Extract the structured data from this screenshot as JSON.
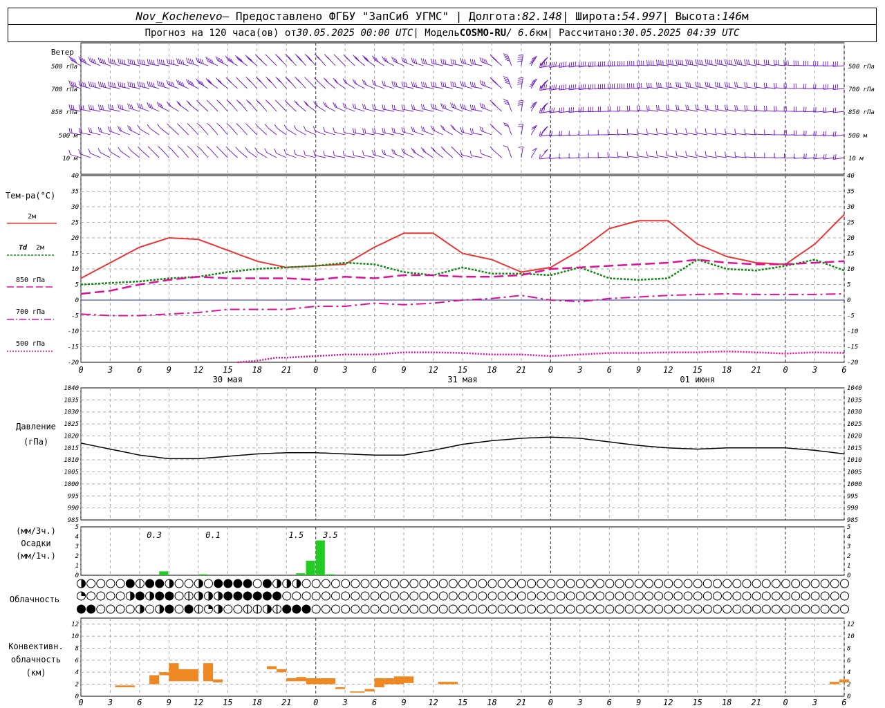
{
  "header": {
    "station": "Nov_Kochenevo",
    "provider": " — Предоставлено ФГБУ \"ЗапСиб УГМС\" | Долгота: ",
    "lon": "82.148",
    "lat_label": " | Широта: ",
    "lat": "54.997",
    "alt_label": " | Высота: ",
    "alt": "146",
    "alt_unit": "м",
    "forecast_prefix": "Прогноз на 120 часа(ов) от ",
    "forecast_time": "30.05.2025 00:00 UTC",
    "model_prefix": "  | Модель ",
    "model": "COSMO-RU",
    "resolution": " / 6.6",
    "res_unit": "км",
    "computed_prefix": " | Рассчитано: ",
    "computed_time": "30.05.2025 04:39 UTC"
  },
  "axis": {
    "hour_labels": [
      "0",
      "3",
      "6",
      "9",
      "12",
      "15",
      "18",
      "21",
      "0",
      "3",
      "6",
      "9",
      "12",
      "15",
      "18",
      "21",
      "0",
      "3",
      "6",
      "9",
      "12",
      "15",
      "18",
      "21",
      "0",
      "3",
      "6"
    ],
    "date_labels": [
      {
        "hour": 15,
        "text": "30 мая"
      },
      {
        "hour": 39,
        "text": "31 мая"
      },
      {
        "hour": 63,
        "text": "01 июня"
      }
    ]
  },
  "labels": {
    "wind_title": "Ветер",
    "wind_levels": [
      "500 гПа",
      "700 гПа",
      "850 гПа",
      "500 м",
      "10 м"
    ],
    "temp_title": "Тем-ра(°C)",
    "legend_2m": "2м",
    "legend_td": "Td",
    "legend_td_2m": "2м",
    "legend_850": "850 гПа",
    "legend_700": "700 гПа",
    "legend_500": "500 гПа",
    "pressure_title": "Давление",
    "pressure_unit": "(гПа)",
    "precip_unit3": "(мм/3ч.)",
    "precip_title": "Осадки",
    "precip_unit1": "(мм/1ч.)",
    "cloud_title": "Облачность",
    "conv_title1": "Конвективн.",
    "conv_title2": "облачность",
    "conv_title3": "(км)"
  },
  "colors": {
    "t2m": "#ee3333",
    "td": "#118811",
    "upper": "#dd1199",
    "pressure": "#000000",
    "precip": "#22cc22",
    "conv": "#ee8822",
    "wind": "#6611cc",
    "zero_line": "#2222cc"
  },
  "chart_data": [
    {
      "type": "line",
      "title": "Ветер",
      "levels": [
        "500 гПа",
        "700 гПа",
        "850 гПа",
        "500 м",
        "10 м"
      ],
      "note": "wind barbs, hourly"
    },
    {
      "type": "line",
      "title": "Тем-ра(°C)",
      "ylim": [
        -20,
        40
      ],
      "yticks": [
        -20,
        -15,
        -10,
        -5,
        0,
        5,
        10,
        15,
        20,
        25,
        30,
        35,
        40
      ],
      "series": [
        {
          "name": "2м",
          "x": [
            0,
            3,
            6,
            9,
            12,
            15,
            18,
            21,
            24,
            27,
            30,
            33,
            36,
            39,
            42,
            45,
            48,
            51,
            54,
            57,
            60,
            63,
            66,
            69,
            72,
            75,
            78
          ],
          "values": [
            7,
            12,
            17,
            20,
            19.5,
            16,
            12.5,
            10.5,
            11,
            11.5,
            17,
            21.5,
            21.5,
            15,
            13,
            9,
            10.5,
            16,
            23,
            25.5,
            25.5,
            18,
            14,
            12,
            11.5,
            18,
            27.5
          ]
        },
        {
          "name": "Td 2м",
          "x": [
            0,
            3,
            6,
            9,
            12,
            15,
            18,
            21,
            24,
            27,
            30,
            33,
            36,
            39,
            42,
            45,
            48,
            51,
            54,
            57,
            60,
            63,
            66,
            69,
            72,
            75,
            78
          ],
          "values": [
            5,
            5.5,
            6,
            7,
            7.5,
            9,
            10,
            10.5,
            11,
            12,
            11.5,
            9,
            8,
            10.5,
            8.5,
            8.5,
            8,
            10.5,
            7,
            6.5,
            7,
            13,
            10,
            9.5,
            11,
            13,
            9.5
          ]
        },
        {
          "name": "850 гПа",
          "x": [
            0,
            3,
            6,
            9,
            12,
            15,
            18,
            21,
            24,
            27,
            30,
            33,
            36,
            39,
            42,
            45,
            48,
            51,
            54,
            57,
            60,
            63,
            66,
            69,
            72,
            75,
            78
          ],
          "values": [
            2,
            3,
            5,
            6.5,
            7.5,
            7,
            7,
            7,
            6.5,
            7.5,
            7,
            8,
            8,
            7.5,
            7.5,
            8,
            10,
            10.5,
            11,
            11.5,
            12,
            13,
            12,
            11.5,
            11.5,
            12,
            12.5
          ]
        },
        {
          "name": "700 гПа",
          "x": [
            0,
            3,
            6,
            9,
            12,
            15,
            18,
            21,
            24,
            27,
            30,
            33,
            36,
            39,
            42,
            45,
            48,
            51,
            54,
            57,
            60,
            63,
            66,
            69,
            72,
            75,
            78
          ],
          "values": [
            -4.5,
            -5,
            -5,
            -4.5,
            -4,
            -3,
            -3,
            -3,
            -2,
            -2,
            -1,
            -1.5,
            -1,
            0,
            0.5,
            1.5,
            0,
            -0.5,
            0.5,
            1,
            1.5,
            1.8,
            2,
            1.8,
            1.8,
            1.8,
            2
          ]
        },
        {
          "name": "500 гПа",
          "x": [
            16,
            18,
            20,
            21,
            24,
            27,
            30,
            33,
            36,
            39,
            42,
            45,
            48,
            51,
            54,
            57,
            60,
            63,
            66,
            69,
            72,
            75,
            78
          ],
          "values": [
            -20,
            -19.5,
            -18.5,
            -18.5,
            -18,
            -17.5,
            -17.5,
            -16.8,
            -16.8,
            -17,
            -17.5,
            -17.5,
            -18,
            -17.5,
            -17,
            -17,
            -16.8,
            -16.8,
            -16.5,
            -16.8,
            -17.2,
            -16.8,
            -17
          ]
        }
      ]
    },
    {
      "type": "line",
      "title": "Давление",
      "ylabel": "(гПа)",
      "ylim": [
        985,
        1040
      ],
      "yticks": [
        985,
        990,
        995,
        1000,
        1005,
        1010,
        1015,
        1020,
        1025,
        1030,
        1035,
        1040
      ],
      "series": [
        {
          "name": "Давление",
          "x": [
            0,
            3,
            6,
            9,
            12,
            15,
            18,
            21,
            24,
            27,
            30,
            33,
            36,
            39,
            42,
            45,
            48,
            51,
            54,
            57,
            60,
            63,
            66,
            69,
            72,
            75,
            78
          ],
          "values": [
            1017,
            1014.5,
            1012,
            1010.5,
            1010.5,
            1011.5,
            1012.5,
            1013,
            1013,
            1012.5,
            1012,
            1012,
            1014,
            1016.5,
            1018,
            1019,
            1019.5,
            1019,
            1017.5,
            1016,
            1015,
            1014.5,
            1015,
            1015,
            1015,
            1014,
            1012.5
          ]
        }
      ]
    },
    {
      "type": "bar",
      "title": "Осадки",
      "ylim": [
        0,
        5
      ],
      "yticks": [
        0,
        1,
        2,
        3,
        4,
        5
      ],
      "bars_mm_per_hour": {
        "x": [
          8,
          12,
          22,
          23,
          24,
          25
        ],
        "values": [
          0.4,
          0.1,
          0.2,
          1.5,
          3.6,
          0.1
        ]
      },
      "totals_mm_per_3h": [
        {
          "hour": 7.5,
          "text": "0.3"
        },
        {
          "hour": 13.5,
          "text": "0.1"
        },
        {
          "hour": 22,
          "text": "1.5"
        },
        {
          "hour": 25.5,
          "text": "3.5"
        }
      ]
    },
    {
      "type": "table",
      "title": "Облачность",
      "note": "cloud cover symbols per hour, 3 tiers; o=clear, q=quarter, h=half, t=three-quarter, f=overcast, v=vertical-half",
      "rows": [
        "hoooofvffhoohoffffofhhhooooooooooooooooooooooooooooooooooooooooooooooooooooooooo",
        "qoooohfhffovhhhffffffoooooooooooooooooooooooooooooooooooooooooooooooooooooooooo",
        "ffoooohohfofvqhoovvhvfffoooooooooooooooooooooooooooooooooooooooooooooooooooooooo"
      ]
    },
    {
      "type": "bar",
      "title": "Конвективн. облачность",
      "ylabel": "(км)",
      "ylim": [
        0,
        13
      ],
      "yticks": [
        0,
        2,
        4,
        6,
        8,
        10,
        12
      ],
      "layers": [
        {
          "x": 3.5,
          "w": 2,
          "base": 1.5,
          "top": 1.8
        },
        {
          "x": 7,
          "w": 1,
          "base": 2,
          "top": 3.5
        },
        {
          "x": 8,
          "w": 1,
          "base": 3.5,
          "top": 4
        },
        {
          "x": 9,
          "w": 1,
          "base": 2.5,
          "top": 5.5
        },
        {
          "x": 10,
          "w": 2,
          "base": 2.5,
          "top": 4.5
        },
        {
          "x": 12.5,
          "w": 1,
          "base": 2.5,
          "top": 5.5
        },
        {
          "x": 13.5,
          "w": 1,
          "base": 2.3,
          "top": 2.8
        },
        {
          "x": 19,
          "w": 1,
          "base": 4.5,
          "top": 5
        },
        {
          "x": 20,
          "w": 1,
          "base": 4,
          "top": 4.5
        },
        {
          "x": 21,
          "w": 1,
          "base": 2.5,
          "top": 3
        },
        {
          "x": 22,
          "w": 1,
          "base": 2.5,
          "top": 3.2
        },
        {
          "x": 23,
          "w": 3,
          "base": 2,
          "top": 3
        },
        {
          "x": 26,
          "w": 1,
          "base": 1.2,
          "top": 1.5
        },
        {
          "x": 27.5,
          "w": 1.5,
          "base": 0.6,
          "top": 0.8
        },
        {
          "x": 29,
          "w": 1,
          "base": 0.8,
          "top": 1.2
        },
        {
          "x": 30,
          "w": 1,
          "base": 1.5,
          "top": 3
        },
        {
          "x": 31,
          "w": 1,
          "base": 2,
          "top": 3
        },
        {
          "x": 32,
          "w": 1,
          "base": 2,
          "top": 3.3
        },
        {
          "x": 33,
          "w": 1,
          "base": 2.2,
          "top": 3.3
        },
        {
          "x": 36.5,
          "w": 2,
          "base": 2,
          "top": 2.4
        },
        {
          "x": 76.5,
          "w": 1,
          "base": 2,
          "top": 2.4
        },
        {
          "x": 77.5,
          "w": 1,
          "base": 2.3,
          "top": 2.8
        }
      ]
    }
  ]
}
